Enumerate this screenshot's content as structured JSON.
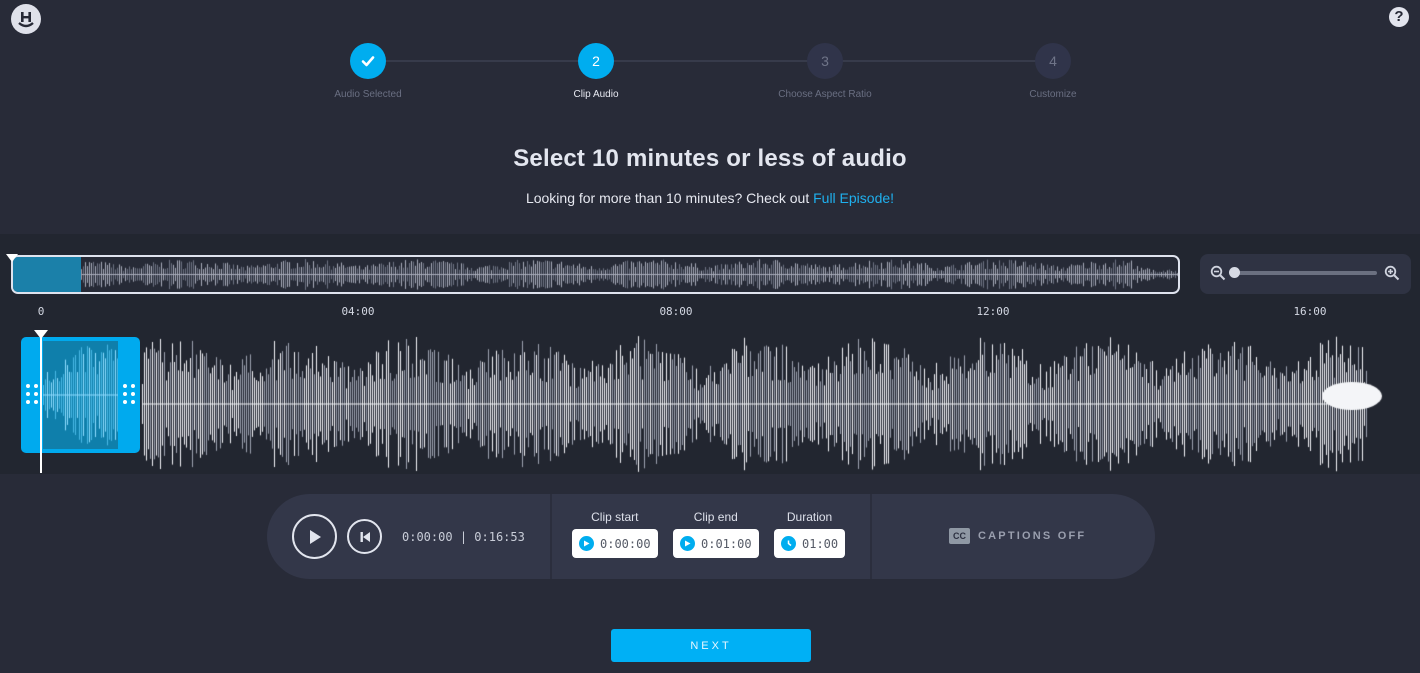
{
  "header": {
    "logo_icon": "smiley-h-logo",
    "help_icon": "question-mark-icon",
    "help_label": "?"
  },
  "stepper": {
    "steps": [
      {
        "number": "1",
        "label": "Audio Selected",
        "state": "done",
        "icon": "check-icon"
      },
      {
        "number": "2",
        "label": "Clip Audio",
        "state": "active"
      },
      {
        "number": "3",
        "label": "Choose Aspect Ratio",
        "state": "todo"
      },
      {
        "number": "4",
        "label": "Customize",
        "state": "todo"
      }
    ]
  },
  "title": "Select 10 minutes or less of audio",
  "subtitle": {
    "text": "Looking for more than 10 minutes? Check out ",
    "link": "Full Episode!"
  },
  "timeline": {
    "ticks": [
      "0",
      "04:00",
      "08:00",
      "12:00",
      "16:00"
    ],
    "zoom": {
      "min_icon": "zoom-out-icon",
      "max_icon": "zoom-in-icon",
      "level": 0
    }
  },
  "player": {
    "play_icon": "play-icon",
    "restart_icon": "skip-back-icon",
    "current_time": "0:00:00",
    "separator": "|",
    "total_time": "0:16:53"
  },
  "clip": {
    "start_label": "Clip start",
    "start_value": "0:00:00",
    "end_label": "Clip end",
    "end_value": "0:01:00",
    "duration_label": "Duration",
    "duration_value": "01:00"
  },
  "captions": {
    "icon_text": "CC",
    "label": "CAPTIONS OFF"
  },
  "next_label": "NEXT",
  "colors": {
    "accent": "#00adef",
    "background": "#282b38",
    "band": "#222630",
    "panel": "#333749"
  }
}
